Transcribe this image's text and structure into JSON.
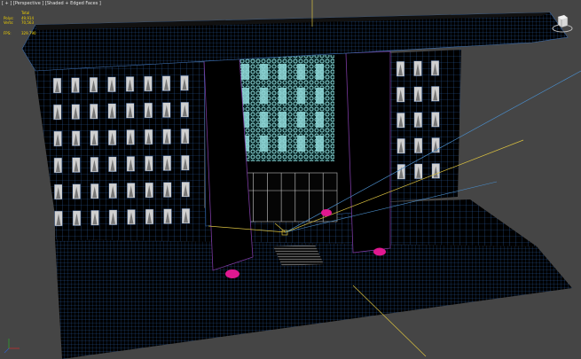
{
  "viewport": {
    "menu_plus": "[ + ]",
    "view": "[Perspective ]",
    "shading": "[Shaded + Edged Faces ]"
  },
  "stats": {
    "header": "Total",
    "rows": [
      {
        "key": "Polys:",
        "value": "49,914"
      },
      {
        "key": "Verts:",
        "value": "70,563"
      }
    ],
    "fps_label": "FPS:",
    "fps_value": "329.790"
  },
  "colors": {
    "background": "#454545",
    "stats_text": "#f0d000",
    "edge_wire": "#2a5a9a",
    "glass": "#8fd8d8",
    "marker": "#e01890",
    "light_ray": "#d9c040",
    "target_ray": "#4a8cc8"
  },
  "icons": {
    "viewcube": "viewcube-icon"
  }
}
